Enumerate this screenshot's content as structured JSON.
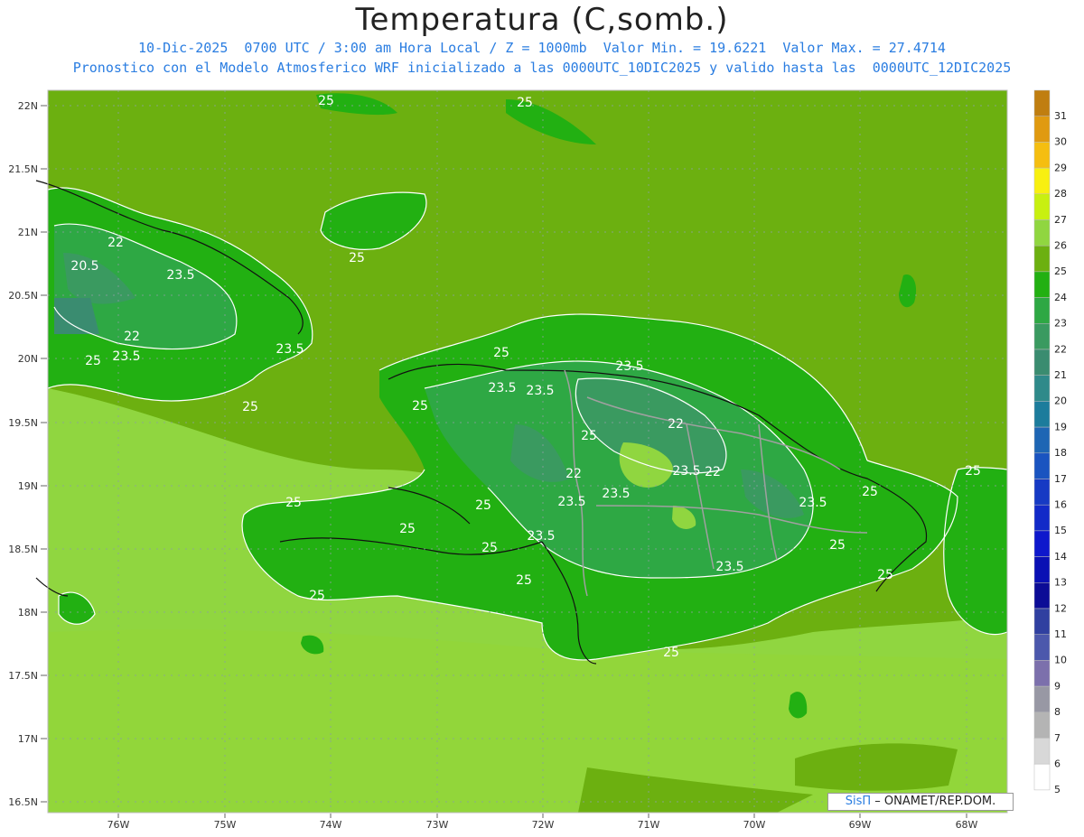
{
  "title": "Temperatura (C,somb.)",
  "subtitle": {
    "datetime": "10-Dic-2025  0700 UTC / 3:00 am Hora Local / Z = 1000mb",
    "min_text": "Valor Min. = 19.6221",
    "max_text": "Valor Max. = 27.4714",
    "line2": "Pronostico con el Modelo Atmosferico WRF inicializado a las 0000UTC_10DIC2025 y valido hasta las  0000UTC_12DIC2025"
  },
  "map": {
    "lon_range": [
      -76.66,
      -67.61
    ],
    "lat_range": [
      16.42,
      22.1
    ],
    "lat_ticks": [
      "22N",
      "21.5N",
      "21N",
      "20.5N",
      "20N",
      "19.5N",
      "19N",
      "18.5N",
      "18N",
      "17.5N",
      "17N",
      "16.5N"
    ],
    "lon_ticks": [
      "76W",
      "75W",
      "74W",
      "73W",
      "72W",
      "71W",
      "70W",
      "69W",
      "68W"
    ],
    "contour_labels": [
      "25",
      "25",
      "25",
      "22",
      "23.5",
      "20.5",
      "22",
      "23.5",
      "25",
      "23.5",
      "25",
      "25",
      "23.5",
      "23.5",
      "23.5",
      "25",
      "22",
      "22",
      "23.5",
      "22",
      "25",
      "23.5",
      "25",
      "25",
      "23.5",
      "23.5",
      "25",
      "25",
      "25",
      "23.5",
      "23.5",
      "25",
      "25",
      "25",
      "25",
      "25",
      "25"
    ]
  },
  "colorbar": {
    "levels": [
      "31",
      "30",
      "29",
      "28",
      "27",
      "26",
      "25",
      "24",
      "23",
      "22",
      "21",
      "20",
      "19",
      "18",
      "17",
      "16",
      "15",
      "14",
      "13",
      "12",
      "11",
      "10",
      "9",
      "8",
      "7",
      "6",
      "5"
    ],
    "colors": [
      "#c07e10",
      "#e09a10",
      "#f5be10",
      "#f8f010",
      "#c8f010",
      "#90d640",
      "#6cb010",
      "#22b012",
      "#2ea844",
      "#3a9a60",
      "#3a8c70",
      "#2f8a8a",
      "#1c7c9c",
      "#1e66b4",
      "#1a54c0",
      "#163ac4",
      "#122ac8",
      "#0e18cc",
      "#0a10b4",
      "#0c0c96",
      "#3040a0",
      "#4c58ac",
      "#7c70ac",
      "#9898a4",
      "#b4b4b4",
      "#d8d8d8",
      "#ffffff"
    ]
  },
  "credit": {
    "brand": "SisΠ",
    "text": " – ONAMET/REP.DOM."
  }
}
